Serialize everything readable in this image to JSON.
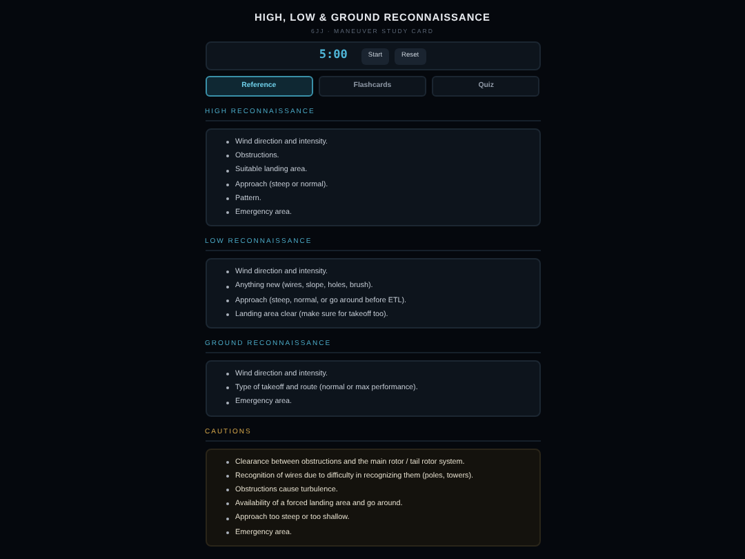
{
  "header": {
    "title": "HIGH, LOW & GROUND RECONNAISSANCE",
    "subtitle": "6JJ · MANEUVER STUDY CARD"
  },
  "timer": {
    "display": "5:00",
    "buttons": [
      "Start",
      "Reset"
    ]
  },
  "tabs": [
    {
      "label": "Reference",
      "selected": true
    },
    {
      "label": "Flashcards",
      "selected": false
    },
    {
      "label": "Quiz",
      "selected": false
    }
  ],
  "sections": [
    {
      "kind": "normal",
      "heading": "HIGH RECONNAISSANCE",
      "items": [
        "Wind direction and intensity.",
        "Obstructions.",
        "Suitable landing area.",
        "Approach (steep or normal).",
        "Pattern.",
        "Emergency area."
      ]
    },
    {
      "kind": "normal",
      "heading": "LOW RECONNAISSANCE",
      "items": [
        "Wind direction and intensity.",
        "Anything new (wires, slope, holes, brush).",
        "Approach (steep, normal, or go around before ETL).",
        "Landing area clear (make sure for takeoff too)."
      ]
    },
    {
      "kind": "normal",
      "heading": "GROUND RECONNAISSANCE",
      "items": [
        "Wind direction and intensity.",
        "Type of takeoff and route (normal or max performance).",
        "Emergency area."
      ]
    },
    {
      "kind": "caution",
      "heading": "CAUTIONS",
      "items": [
        "Clearance between obstructions and the main rotor / tail rotor system.",
        "Recognition of wires due to difficulty in recognizing them (poles, towers).",
        "Obstructions cause turbulence.",
        "Availability of a forced landing area and go around.",
        "Approach too steep or too shallow.",
        "Emergency area."
      ]
    }
  ]
}
